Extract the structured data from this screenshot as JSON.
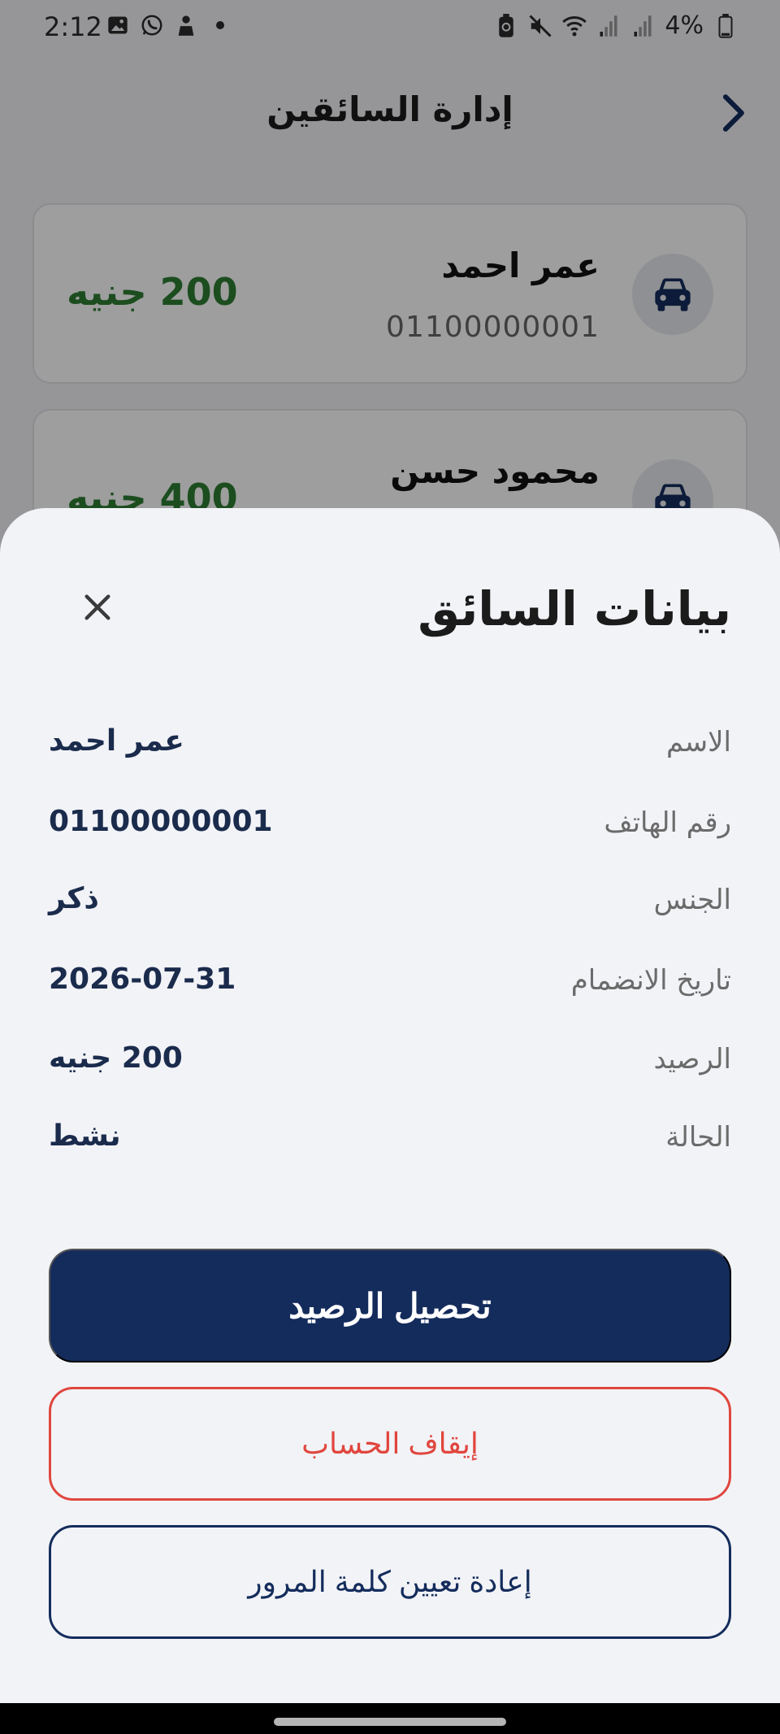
{
  "status_bar": {
    "time": "2:12",
    "battery_percent": "4%",
    "left_icons": [
      "gallery-icon",
      "whatsapp-icon",
      "agent-icon",
      "dot-icon"
    ],
    "right_icons": [
      "battery-saver-icon",
      "mute-icon",
      "wifi-icon",
      "signal-icon",
      "signal-icon",
      "battery-icon"
    ]
  },
  "header": {
    "title": "إدارة السائقين"
  },
  "drivers": [
    {
      "name": "عمر احمد",
      "phone": "01100000001",
      "balance": "200 جنيه"
    },
    {
      "name": "محمود حسن",
      "balance": "400 جنيه"
    }
  ],
  "sheet": {
    "title": "بيانات السائق",
    "rows": [
      {
        "label": "الاسم",
        "value": "عمر احمد"
      },
      {
        "label": "رقم الهاتف",
        "value": "01100000001"
      },
      {
        "label": "الجنس",
        "value": "ذكر"
      },
      {
        "label": "تاريخ الانضمام",
        "value": "2026-07-31"
      },
      {
        "label": "الرصيد",
        "value": "200 جنيه"
      },
      {
        "label": "الحالة",
        "value": "نشط"
      }
    ],
    "buttons": {
      "collect": "تحصيل الرصيد",
      "suspend": "إيقاف الحساب",
      "reset_password": "إعادة تعيين كلمة المرور"
    }
  },
  "colors": {
    "primary": "#142c5c",
    "danger": "#e0463e",
    "balance_green": "#2e7d32",
    "sheet_bg": "#f2f3f7"
  }
}
